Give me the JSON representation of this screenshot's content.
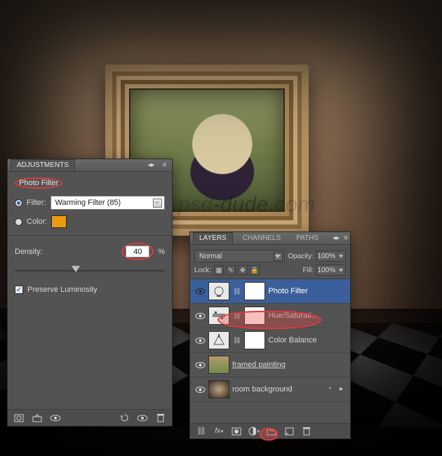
{
  "watermark": "www.psd-dude.com",
  "adjustments": {
    "panel_title": "ADJUSTMENTS",
    "type_label": "Photo Filter",
    "filter_label": "Filter:",
    "filter_value": "Warming Filter (85)",
    "filter_selected": true,
    "color_label": "Color:",
    "color_swatch": "#ef9b12",
    "density_label": "Density:",
    "density_value": "40",
    "density_unit": "%",
    "preserve_label": "Preserve Luminosity",
    "preserve_checked": true,
    "footer_icons": [
      "adjustment-layer-icon",
      "clip-to-layer-icon",
      "view-previous-icon",
      "reset-icon",
      "toggle-visibility-icon",
      "delete-icon"
    ]
  },
  "layers": {
    "tabs": [
      "LAYERS",
      "CHANNELS",
      "PATHS"
    ],
    "blend_mode": "Normal",
    "opacity_label": "Opacity:",
    "opacity_value": "100%",
    "lock_label": "Lock:",
    "fill_label": "Fill:",
    "fill_value": "100%",
    "items": [
      {
        "name": "Photo Filter",
        "kind": "adjustment",
        "selected": true
      },
      {
        "name": "Hue/Saturati...",
        "kind": "adjustment",
        "selected": false
      },
      {
        "name": "Color Balance",
        "kind": "adjustment",
        "selected": false
      },
      {
        "name": "framed painting",
        "kind": "smart",
        "selected": false,
        "underline": true
      },
      {
        "name": "room background",
        "kind": "image",
        "selected": false
      }
    ],
    "footer_icons": [
      "link-icon",
      "fx-icon",
      "mask-icon",
      "adjustment-icon",
      "group-icon",
      "new-layer-icon",
      "delete-icon"
    ]
  }
}
